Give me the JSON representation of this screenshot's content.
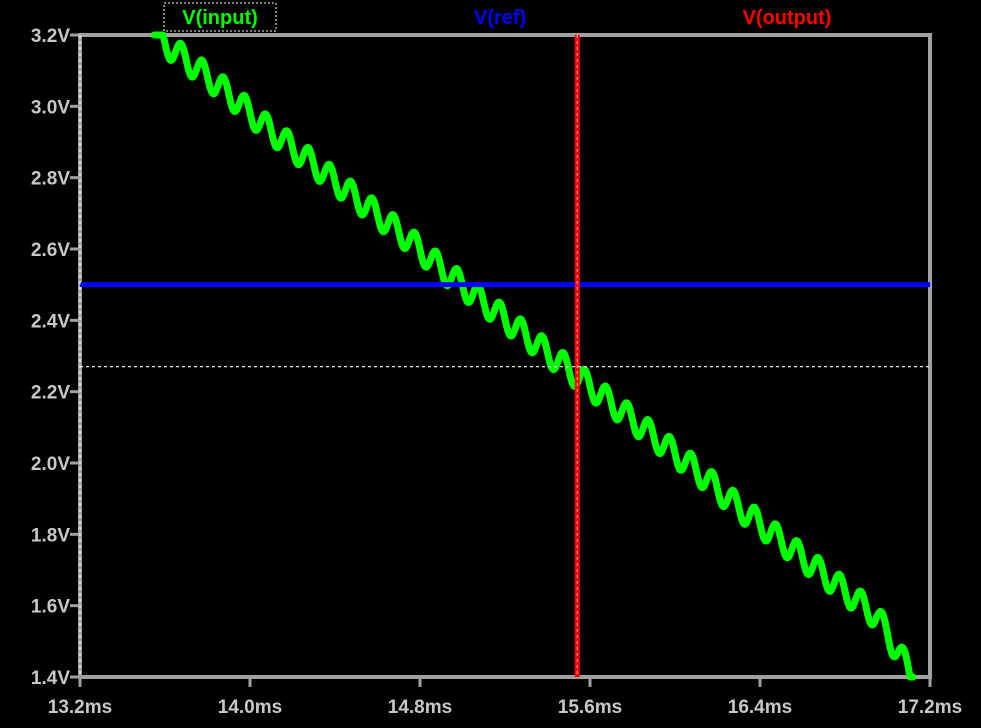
{
  "chart_data": {
    "type": "line",
    "title": "",
    "xlabel": "",
    "ylabel": "",
    "xlim": [
      13.2,
      17.2
    ],
    "ylim": [
      1.4,
      3.2
    ],
    "x_unit": "ms",
    "y_unit": "V",
    "x_ticks": [
      "13.2ms",
      "14.0ms",
      "14.8ms",
      "15.6ms",
      "16.4ms",
      "17.2ms"
    ],
    "x_tick_values": [
      13.2,
      14.0,
      14.8,
      15.6,
      16.4,
      17.2
    ],
    "y_ticks": [
      "1.4V",
      "1.6V",
      "1.8V",
      "2.0V",
      "2.2V",
      "2.4V",
      "2.6V",
      "2.8V",
      "3.0V",
      "3.2V"
    ],
    "y_tick_values": [
      1.4,
      1.6,
      1.8,
      2.0,
      2.2,
      2.4,
      2.6,
      2.8,
      3.0,
      3.2
    ],
    "grid": false,
    "legend_position": "top",
    "series": [
      {
        "name": "V(input)",
        "color": "#00ff00",
        "description_shape": "descending ramp with small periodic ripple",
        "x": [
          13.55,
          13.72,
          13.89,
          14.06,
          14.23,
          14.4,
          14.57,
          14.74,
          14.91,
          15.08,
          15.25,
          15.42,
          15.59,
          15.76,
          15.93,
          16.1,
          16.27,
          16.44,
          16.61,
          16.78,
          16.95,
          17.12
        ],
        "y": [
          3.2,
          3.12,
          3.04,
          2.95,
          2.87,
          2.79,
          2.71,
          2.63,
          2.54,
          2.46,
          2.38,
          2.3,
          2.22,
          2.14,
          2.06,
          1.98,
          1.89,
          1.81,
          1.73,
          1.65,
          1.57,
          1.4
        ],
        "ripple_amplitude": 0.035,
        "ripple_period_ms": 0.1
      },
      {
        "name": "V(ref)",
        "color": "#0000ff",
        "x": [
          13.2,
          17.2
        ],
        "y": [
          2.5,
          2.5
        ]
      },
      {
        "name": "V(output)",
        "color": "#ff0000",
        "x": [
          15.54,
          15.54
        ],
        "y": [
          1.4,
          3.2
        ]
      }
    ],
    "cursor": {
      "x": 13.2,
      "y": 2.27,
      "color": "#ffffff"
    }
  }
}
